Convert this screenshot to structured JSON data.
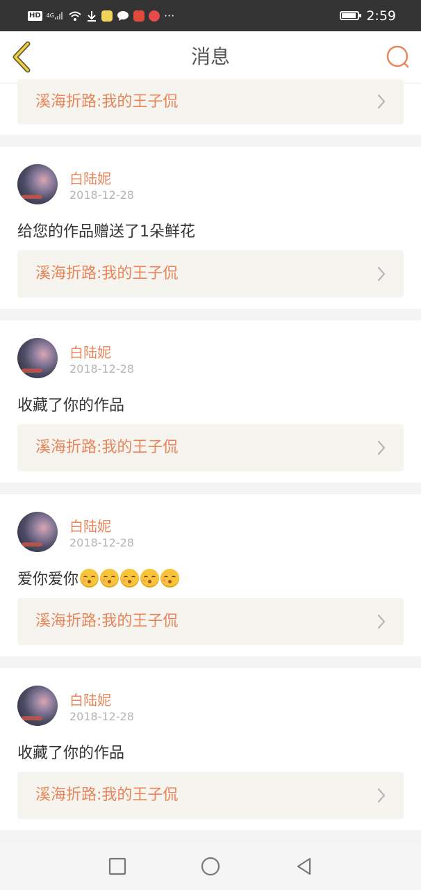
{
  "status_bar": {
    "left_icons": [
      "hd-icon",
      "signal-icon",
      "wifi-icon",
      "download-icon",
      "app-icon-1",
      "chat-icon",
      "app-icon-2",
      "app-icon-3",
      "more-icon"
    ],
    "hd_label": "HD",
    "network_label": "4G",
    "more_label": "···",
    "time": "2:59"
  },
  "header": {
    "title": "消息",
    "accent_color": "#e8855a"
  },
  "top_partial": {
    "link_text": "溪海折路:我的王子侃"
  },
  "messages": [
    {
      "user": "白陆妮",
      "date": "2018-12-28",
      "text": "给您的作品赠送了1朵鲜花",
      "emoji_count": 0,
      "link_text": "溪海折路:我的王子侃"
    },
    {
      "user": "白陆妮",
      "date": "2018-12-28",
      "text": "收藏了你的作品",
      "emoji_count": 0,
      "link_text": "溪海折路:我的王子侃"
    },
    {
      "user": "白陆妮",
      "date": "2018-12-28",
      "text": "爱你爱你",
      "emoji_count": 5,
      "link_text": "溪海折路:我的王子侃"
    },
    {
      "user": "白陆妮",
      "date": "2018-12-28",
      "text": "收藏了你的作品",
      "emoji_count": 0,
      "link_text": "溪海折路:我的王子侃"
    }
  ],
  "nav_bar": {
    "buttons": [
      "recents-square-icon",
      "home-circle-icon",
      "back-triangle-icon"
    ]
  }
}
